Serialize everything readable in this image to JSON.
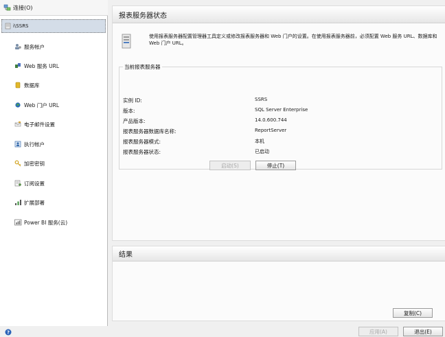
{
  "sidebar": {
    "connect_label": "连接(O)",
    "server_node": "i\\SSRS",
    "items": [
      {
        "label": "服务帐户",
        "icon": "service-account-icon"
      },
      {
        "label": "Web 服务 URL",
        "icon": "web-service-url-icon"
      },
      {
        "label": "数据库",
        "icon": "database-icon"
      },
      {
        "label": "Web 门户 URL",
        "icon": "web-portal-url-icon"
      },
      {
        "label": "电子邮件设置",
        "icon": "email-settings-icon"
      },
      {
        "label": "执行帐户",
        "icon": "execution-account-icon"
      },
      {
        "label": "加密密钥",
        "icon": "encryption-keys-icon"
      },
      {
        "label": "订阅设置",
        "icon": "subscription-settings-icon"
      },
      {
        "label": "扩展部署",
        "icon": "scale-out-deployment-icon"
      },
      {
        "label": "Power BI 服务(云)",
        "icon": "power-bi-service-icon"
      }
    ]
  },
  "main": {
    "title": "报表服务器状态",
    "intro": "使用报表服务器配置管理器工具定义或修改报表服务器和 Web 门户的设置。在使用报表服务器前，必须配置 Web 服务 URL、数据库和 Web 门户 URL。",
    "group_title": "当前报表服务器",
    "properties": [
      {
        "label": "实例 ID:",
        "value": "SSRS"
      },
      {
        "label": "版本:",
        "value": "SQL Server Enterprise"
      },
      {
        "label": "产品版本:",
        "value": "14.0.600.744"
      },
      {
        "label": "报表服务器数据库名称:",
        "value": "ReportServer"
      },
      {
        "label": "报表服务器模式:",
        "value": "本机"
      },
      {
        "label": "报表服务器状态:",
        "value": "已启动"
      }
    ],
    "start_label": "启动(S)",
    "stop_label": "停止(T)"
  },
  "results": {
    "title": "结果",
    "copy_label": "复制(C)"
  },
  "footer": {
    "apply_label": "应用(A)",
    "exit_label": "退出(E)"
  },
  "colors": {
    "selected_node_bg": "#d4dde8",
    "header_gradient_top": "#ffffff",
    "header_gradient_bottom": "#e6e6e6",
    "window_bg": "#f0f0f0",
    "disabled_text": "#a8a8a8",
    "help_icon": "#2a62b8"
  }
}
